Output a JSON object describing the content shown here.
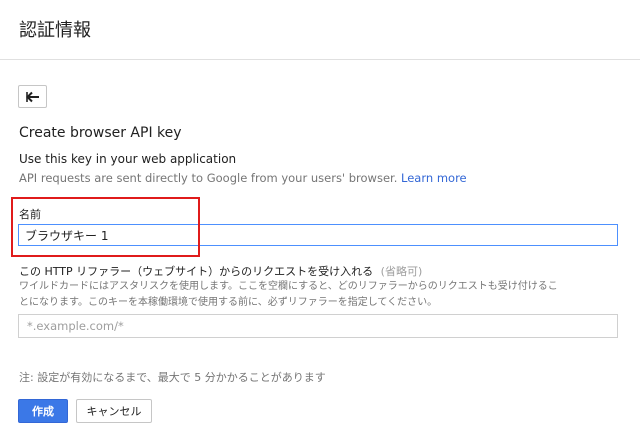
{
  "header": {
    "title": "認証情報"
  },
  "back_button": {
    "icon": "arrow-left-icon"
  },
  "form": {
    "title": "Create browser API key",
    "usage_heading": "Use this key in your web application",
    "usage_desc": "API requests are sent directly to Google from your users' browser.",
    "learn_more": "Learn more",
    "name_label": "名前",
    "name_value": "ブラウザキー 1",
    "referrer_label": "この HTTP リファラー（ウェブサイト）からのリクエストを受け入れる",
    "referrer_optional": "(省略可)",
    "referrer_help_line1": "ワイルドカードにはアスタリスクを使用します。ここを空欄にすると、どのリファラーからのリクエストも受け付けるこ",
    "referrer_help_line2": "とになります。このキーを本稼働環境で使用する前に、必ずリファラーを指定してください。",
    "referrer_placeholder": "*.example.com/*",
    "note": "注: 設定が有効になるまで、最大で 5 分かかることがあります",
    "create_label": "作成",
    "cancel_label": "キャンセル"
  },
  "colors": {
    "primary": "#3b78e7",
    "link": "#3367d6",
    "highlight": "#e01b1b",
    "focus_border": "#4d90fe"
  }
}
